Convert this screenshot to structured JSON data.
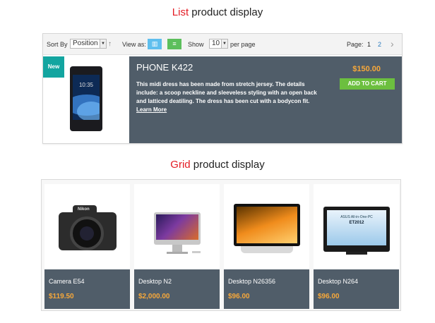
{
  "list_section": {
    "title_accent": "List",
    "title_rest": " product display"
  },
  "grid_section": {
    "title_accent": "Grid",
    "title_rest": " product display"
  },
  "toolbar": {
    "sort_label": "Sort By",
    "sort_value": "Position",
    "sort_dir_icon": "up-arrow-icon",
    "view_label": "View as:",
    "show_label": "Show",
    "limit_value": "10",
    "per_page_label": "per page",
    "page_label": "Page:",
    "pages": [
      "1",
      "2"
    ],
    "next_icon": "chevron-right-icon"
  },
  "list_product": {
    "badge": "New",
    "name": "PHONE K422",
    "description": "This midi dress has been made from stretch jersey. The details include: a scoop neckline and sleeveless styling with an open back and latticed deatiling. The dress has been cut with a bodycon fit. ",
    "learn_more": "Learn More",
    "price": "$150.00",
    "add_to_cart": "ADD TO CART",
    "phone_clock": "10:35"
  },
  "grid_products": [
    {
      "name": "Camera E54",
      "price": "$119.50",
      "brand": "Nikon"
    },
    {
      "name": "Desktop N2",
      "price": "$2,000.00"
    },
    {
      "name": "Desktop N26356",
      "price": "$96.00"
    },
    {
      "name": "Desktop N264",
      "price": "$96.00",
      "screen_line1": "ASUS All-in-One-PC",
      "screen_line2": "ET2012"
    }
  ],
  "colors": {
    "accent_red": "#e41b23",
    "panel_dark": "#505d69",
    "price_orange": "#f7a83a",
    "cart_green": "#6cbf3f",
    "badge_teal": "#13a5a0",
    "view_list_blue": "#5fbfee",
    "view_grid_green": "#5cbf5c"
  }
}
